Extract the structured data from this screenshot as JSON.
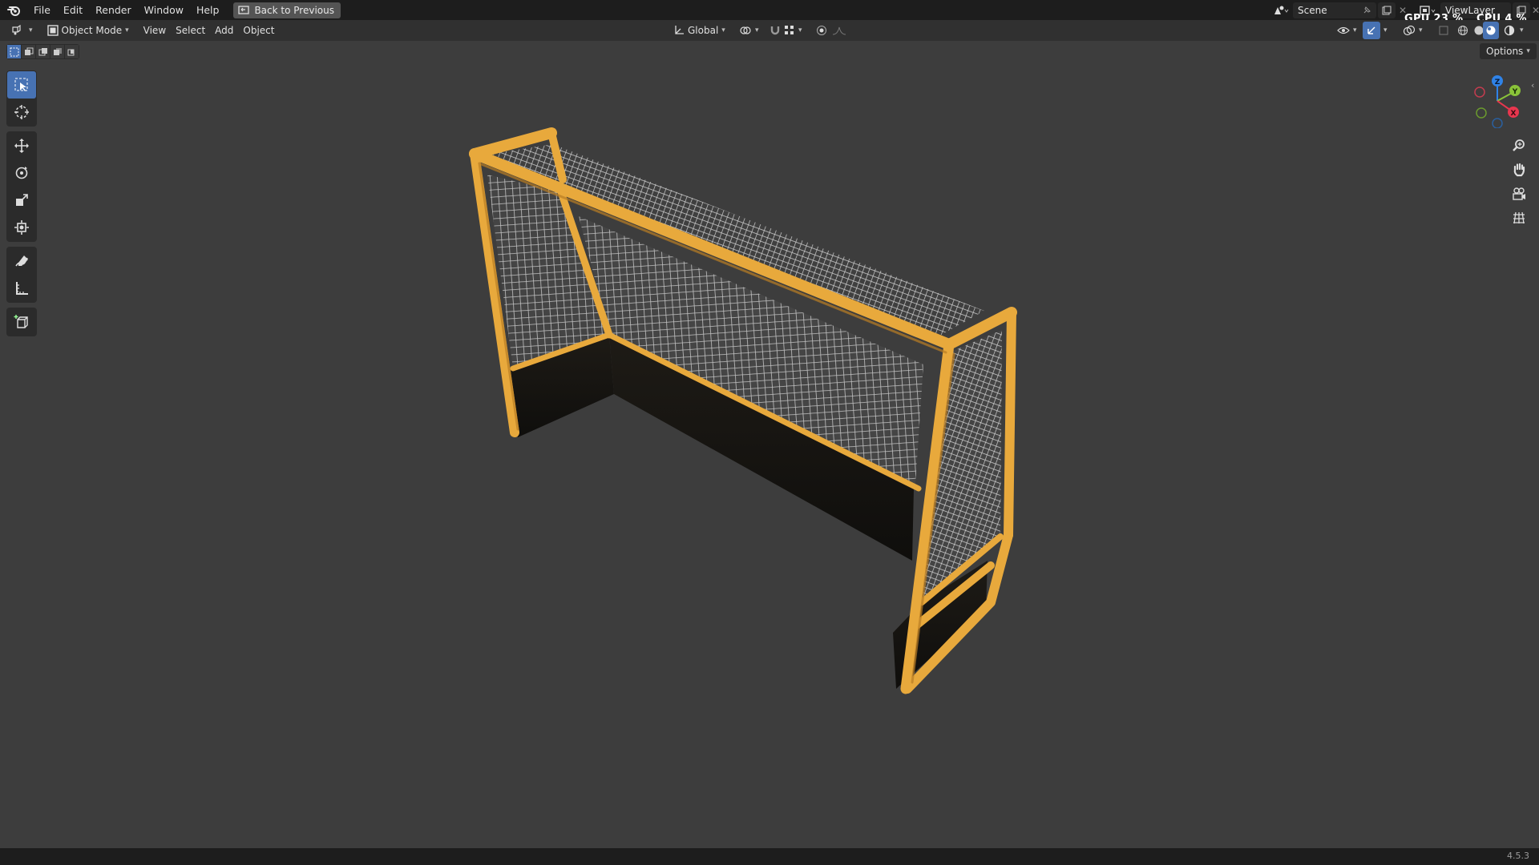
{
  "menu": {
    "items": [
      "File",
      "Edit",
      "Render",
      "Window",
      "Help"
    ],
    "back_button": "Back to Previous"
  },
  "scene": {
    "name": "Scene",
    "view_layer": "ViewLayer"
  },
  "perf": {
    "gpu_label": "GPU",
    "gpu_value": "23 %",
    "cpu_label": "CPU",
    "cpu_value": "4 %"
  },
  "header": {
    "mode": "Object Mode",
    "menus": [
      "View",
      "Select",
      "Add",
      "Object"
    ],
    "orientation": "Global",
    "options": "Options"
  },
  "gizmo": {
    "z": "Z",
    "y": "Y",
    "x": "X"
  },
  "status": {
    "version": "4.5.3"
  },
  "colors": {
    "accent": "#4772b3",
    "frame": "#e8a93c",
    "background": "#3d3d3d"
  },
  "icons": {
    "toolbar": [
      "select-box-icon",
      "cursor-icon",
      "move-icon",
      "rotate-icon",
      "scale-icon",
      "transform-icon",
      "annotate-icon",
      "measure-icon",
      "add-cube-icon"
    ],
    "nav": [
      "zoom-icon",
      "hand-pan-icon",
      "camera-icon",
      "grid-ortho-icon"
    ]
  }
}
